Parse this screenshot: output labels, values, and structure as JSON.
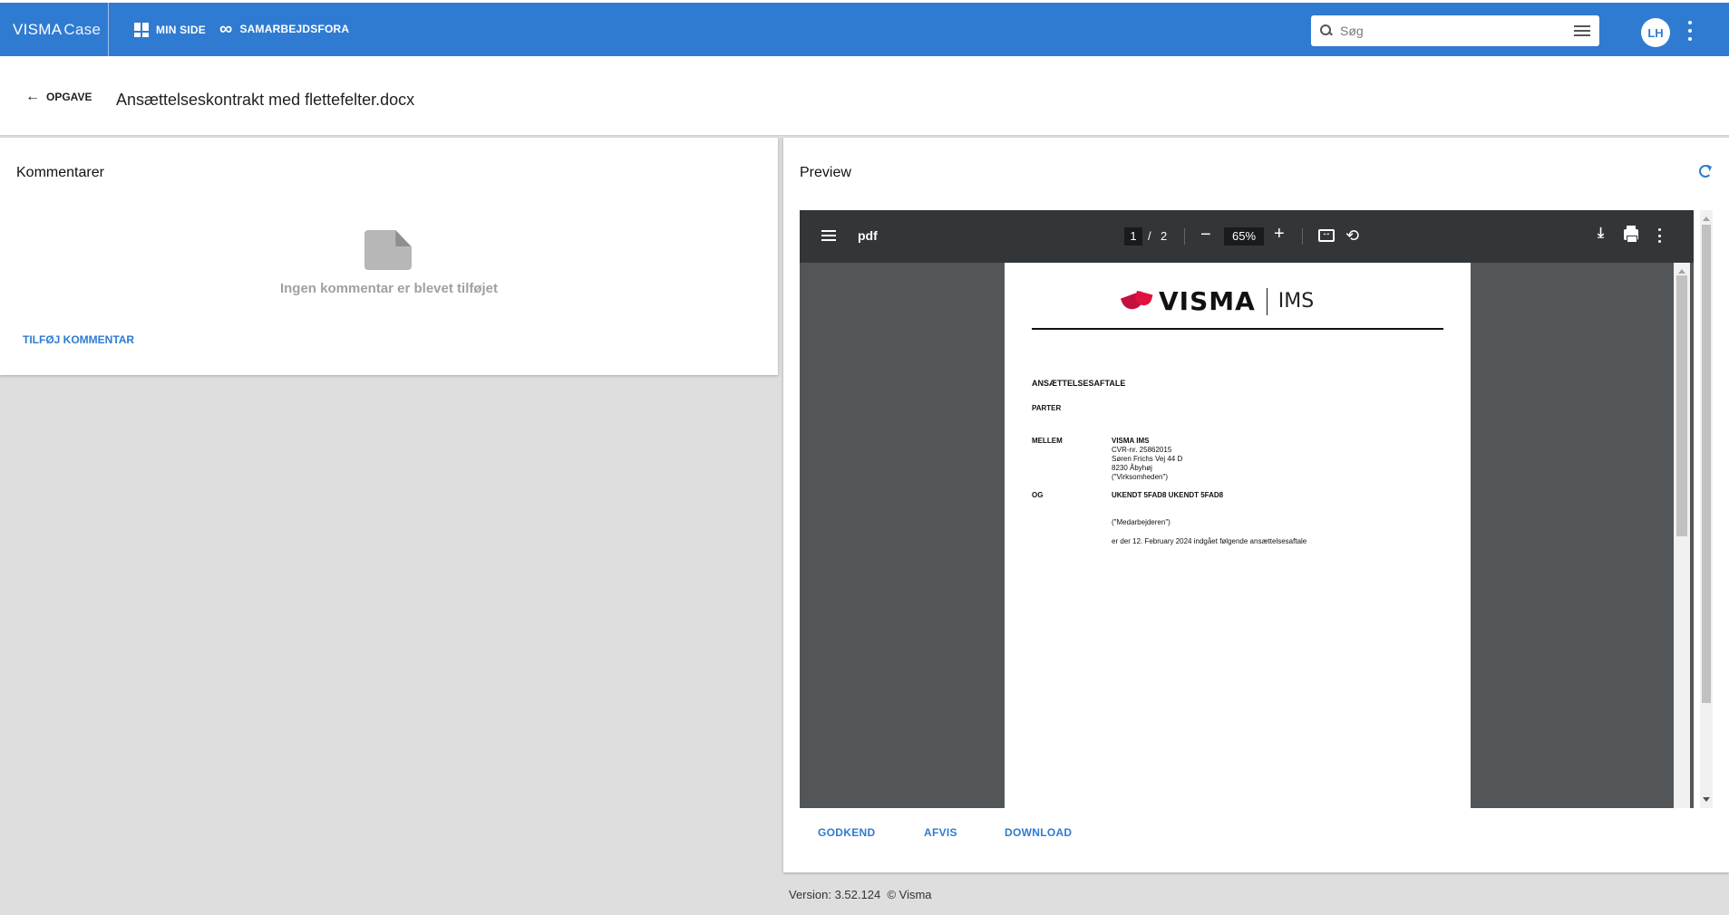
{
  "app": {
    "brand_main": "VISMA",
    "brand_sub": "Case"
  },
  "nav": {
    "items": [
      {
        "label": "MIN SIDE",
        "icon": "dashboard-icon"
      },
      {
        "label": "SAMARBEJDSFORA",
        "icon": "infinity-icon"
      }
    ]
  },
  "search": {
    "placeholder": "Søg",
    "value": ""
  },
  "user": {
    "initials": "LH"
  },
  "header": {
    "back_label": "OPGAVE",
    "title": "Ansættelseskontrakt med flettefelter.docx"
  },
  "comments": {
    "title": "Kommentarer",
    "empty_text": "Ingen kommentar er blevet tilføjet",
    "add_label": "TILFØJ KOMMENTAR"
  },
  "preview": {
    "title": "Preview",
    "viewer": {
      "file_name": "pdf",
      "current_page": "1",
      "page_separator": "/",
      "total_pages": "2",
      "zoom": "65%"
    },
    "document": {
      "logo_text": "VISMA",
      "logo_suffix": "IMS",
      "heading": "ANSÆTTELSESAFTALE",
      "parter": "PARTER",
      "mellem": "MELLEM",
      "company_name": "VISMA IMS",
      "cvr": "CVR-nr. 25862015",
      "address": "Søren Frichs Vej 44 D",
      "city": "8230 Åbyhøj",
      "company_alias": "(\"Virksomheden\")",
      "og": "OG",
      "employee_name": "UKENDT 5FAD8 UKENDT 5FAD8",
      "employee_alias": "(\"Medarbejderen\")",
      "agreement_line": "er der 12. February 2024 indgået følgende ansættelsesaftale"
    },
    "actions": {
      "approve": "GODKEND",
      "reject": "AFVIS",
      "download": "DOWNLOAD"
    }
  },
  "footer": {
    "version": "Version: 3.52.124",
    "copyright": "© Visma"
  },
  "colors": {
    "primary": "#2f7bd1",
    "background": "#dedede",
    "viewer_toolbar": "#323639",
    "viewer_bg": "#525659",
    "visma_red": "#c4103d"
  }
}
